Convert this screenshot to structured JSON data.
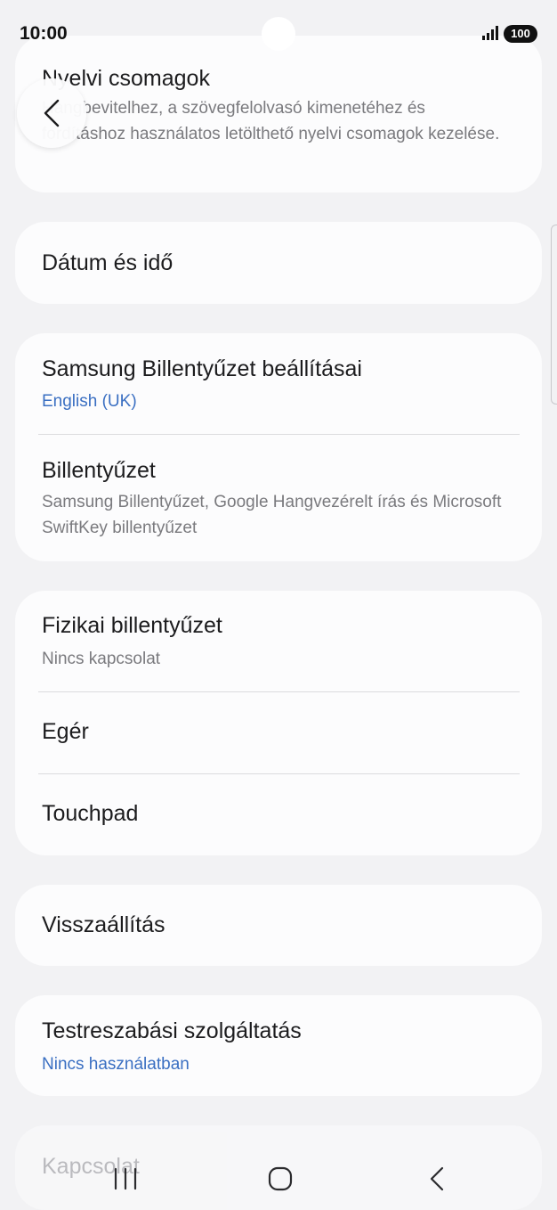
{
  "status_bar": {
    "time": "10:00",
    "battery": "100",
    "signal_icon": "signal-bars-icon"
  },
  "nav": {
    "back_icon": "chevron-left-icon"
  },
  "sections": {
    "language_packs": {
      "title": "Nyelvi csomagok",
      "subtitle": "Hangbevitelhez, a szövegfelolvasó kimenetéhez és fordításhoz használatos letölthető nyelvi csomagok kezelése."
    },
    "date_time": {
      "title": "Dátum és idő"
    },
    "keyboard": {
      "samsung_title": "Samsung Billentyűzet beállításai",
      "samsung_value": "English (UK)",
      "keyboard_title": "Billentyűzet",
      "keyboard_subtitle": "Samsung Billentyűzet, Google Hangvezérelt írás és Microsoft SwiftKey billentyűzet"
    },
    "physical": {
      "physical_title": "Fizikai billentyűzet",
      "physical_value": "Nincs kapcsolat",
      "mouse_title": "Egér",
      "touchpad_title": "Touchpad"
    },
    "reset": {
      "title": "Visszaállítás"
    },
    "customization": {
      "title": "Testreszabási szolgáltatás",
      "value": "Nincs használatban"
    },
    "contact": {
      "title": "Kapcsolat"
    }
  },
  "navbar": {
    "recents_icon": "recents-icon",
    "home_icon": "home-icon",
    "back_icon": "back-icon"
  },
  "colors": {
    "background": "#f2f2f4",
    "card": "#fcfcfd",
    "accent_blue": "#3a6fc2",
    "secondary_text": "#7a7a7e"
  }
}
